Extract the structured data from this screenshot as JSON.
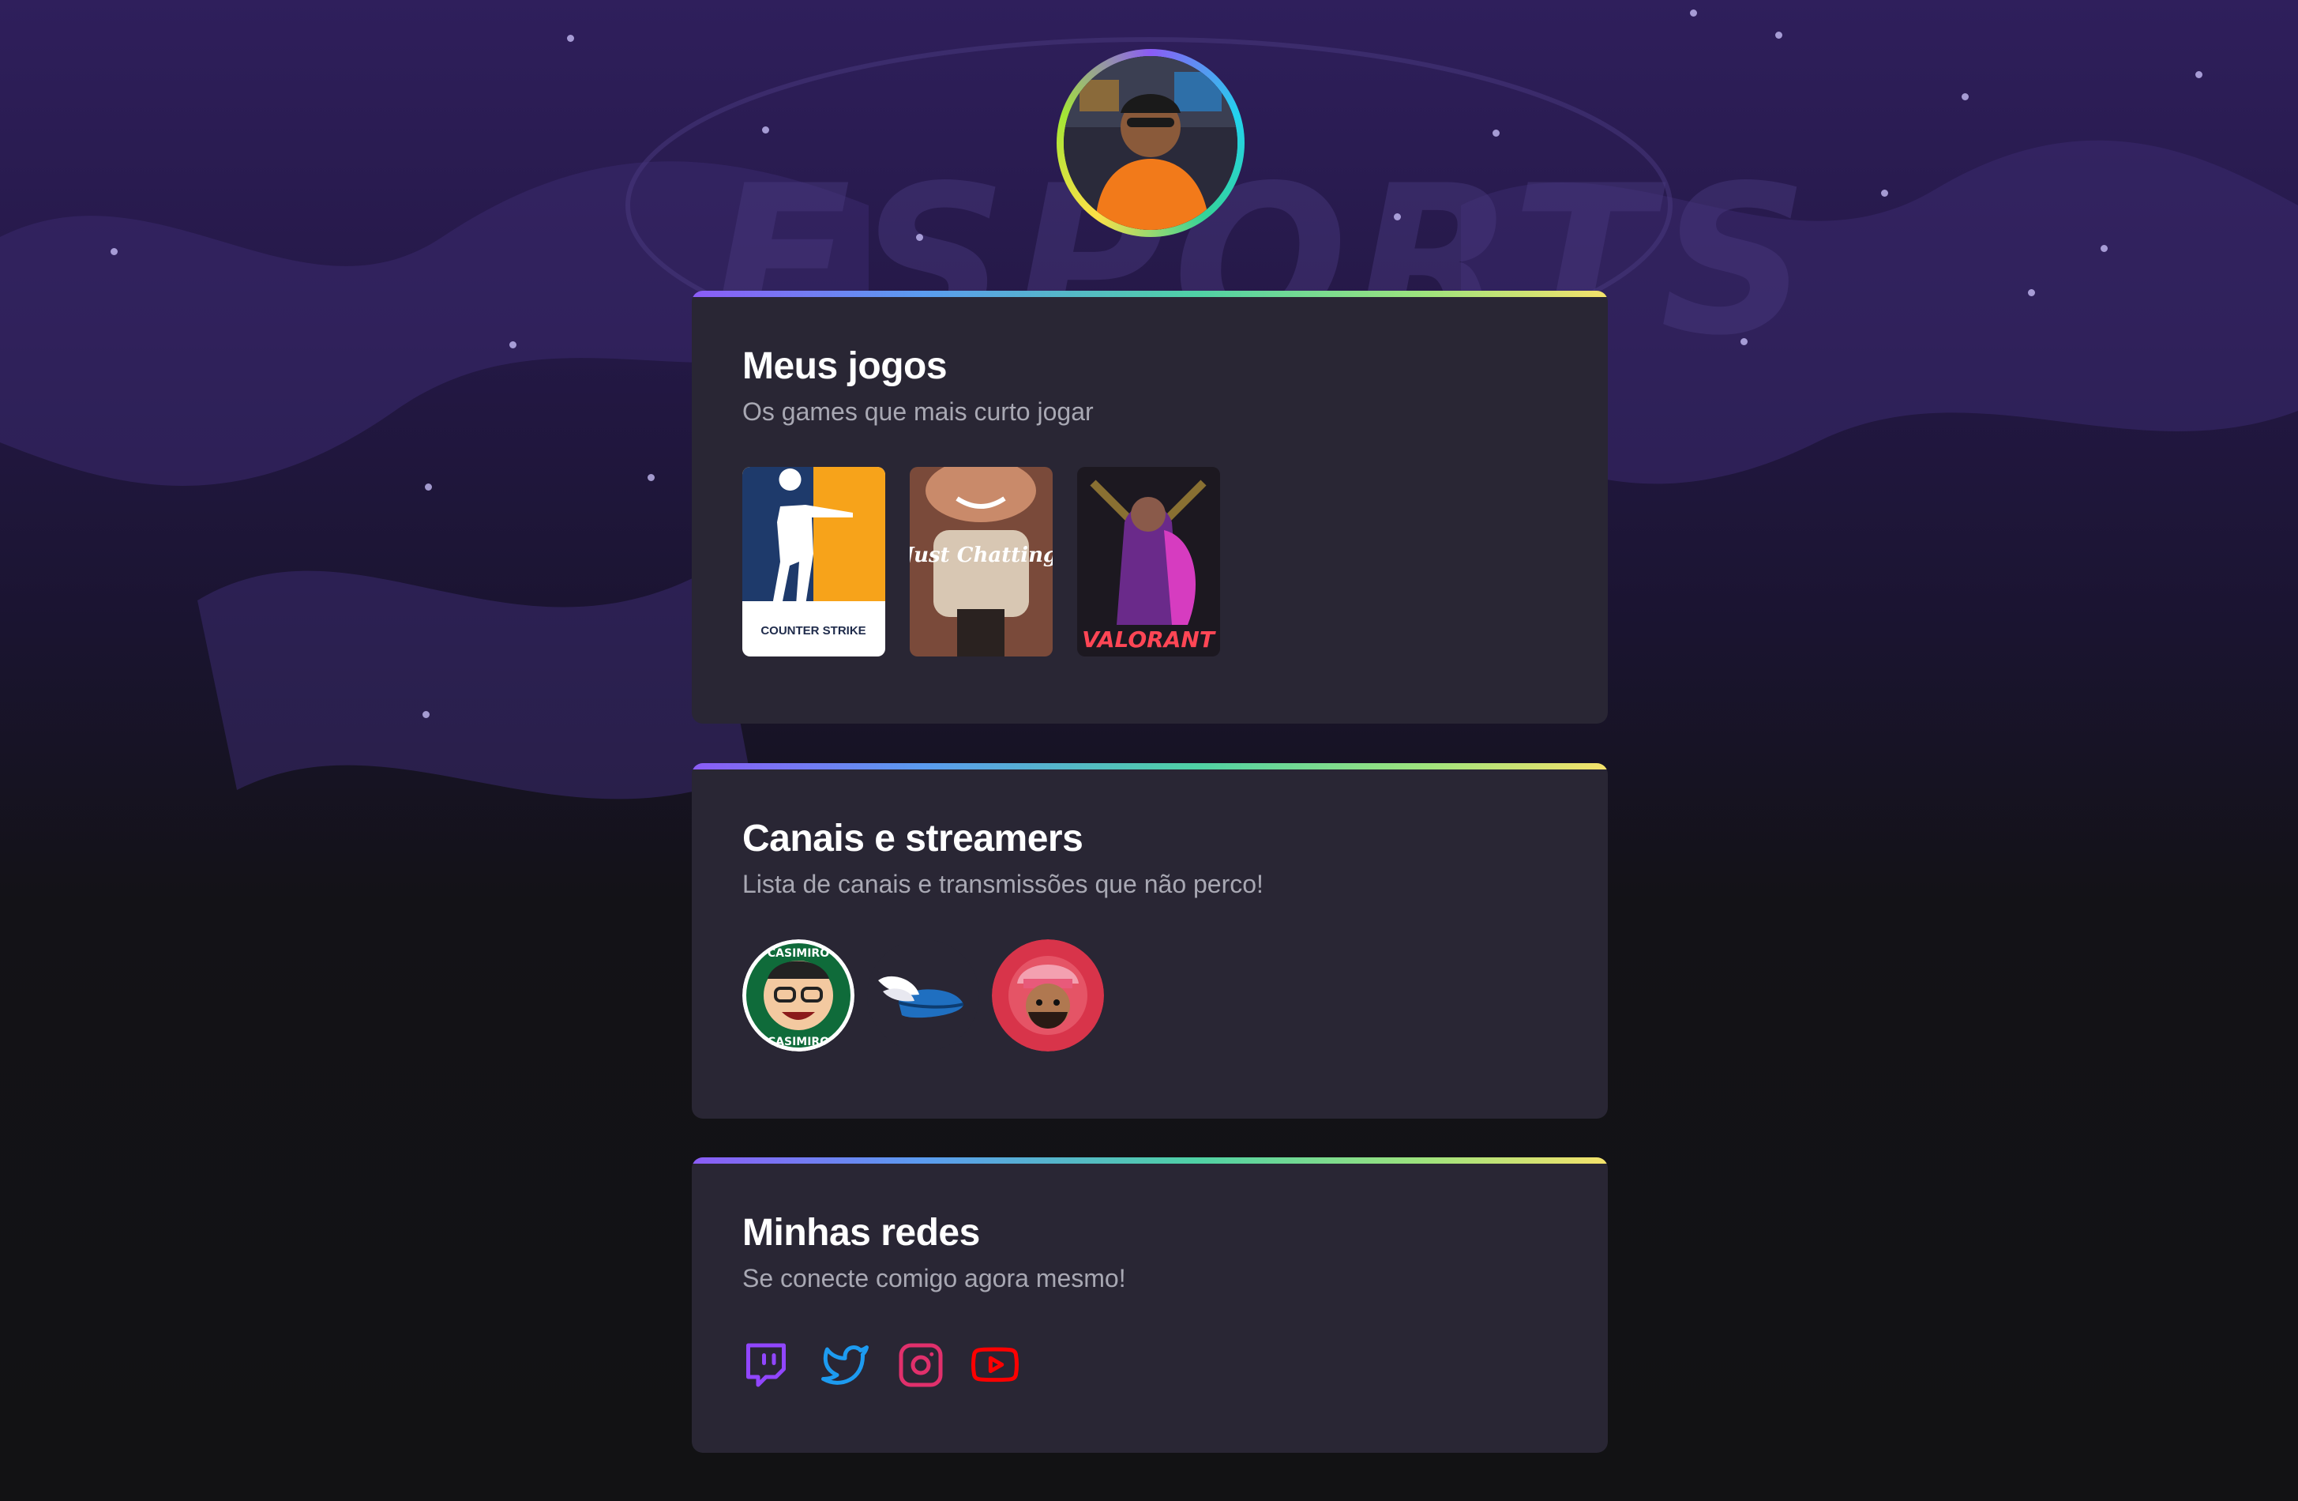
{
  "profile": {
    "avatar_icon": "user-avatar-photo",
    "ring_colors": [
      "#8b5cf6",
      "#22d3ee",
      "#34d399",
      "#fde047"
    ]
  },
  "sections": {
    "games": {
      "title": "Meus jogos",
      "subtitle": "Os games que mais curto jogar",
      "items": [
        {
          "name": "counter-strike",
          "label": "COUNTER STRIKE"
        },
        {
          "name": "just-chatting",
          "label": "Just Chatting"
        },
        {
          "name": "valorant",
          "label": "VALORANT"
        }
      ]
    },
    "channels": {
      "title": "Canais e streamers",
      "subtitle": "Lista de canais e transmissões que não perco!",
      "items": [
        {
          "name": "casimiro",
          "label": "CASIMIRO",
          "label_bottom": "CASIMIRO"
        },
        {
          "name": "winged-shoe",
          "label": ""
        },
        {
          "name": "streamer-red",
          "label": ""
        }
      ]
    },
    "socials": {
      "title": "Minhas redes",
      "subtitle": "Se conecte comigo agora mesmo!",
      "items": [
        {
          "name": "twitch-icon",
          "color": "#9146ff"
        },
        {
          "name": "twitter-icon",
          "color": "#1d9bf0"
        },
        {
          "name": "instagram-icon",
          "color": "#e1306c"
        },
        {
          "name": "youtube-icon",
          "color": "#ff0000"
        }
      ]
    }
  },
  "colors": {
    "background": "#121214",
    "card": "#292634",
    "title": "#ffffff",
    "subtitle": "#a8a8b3"
  }
}
